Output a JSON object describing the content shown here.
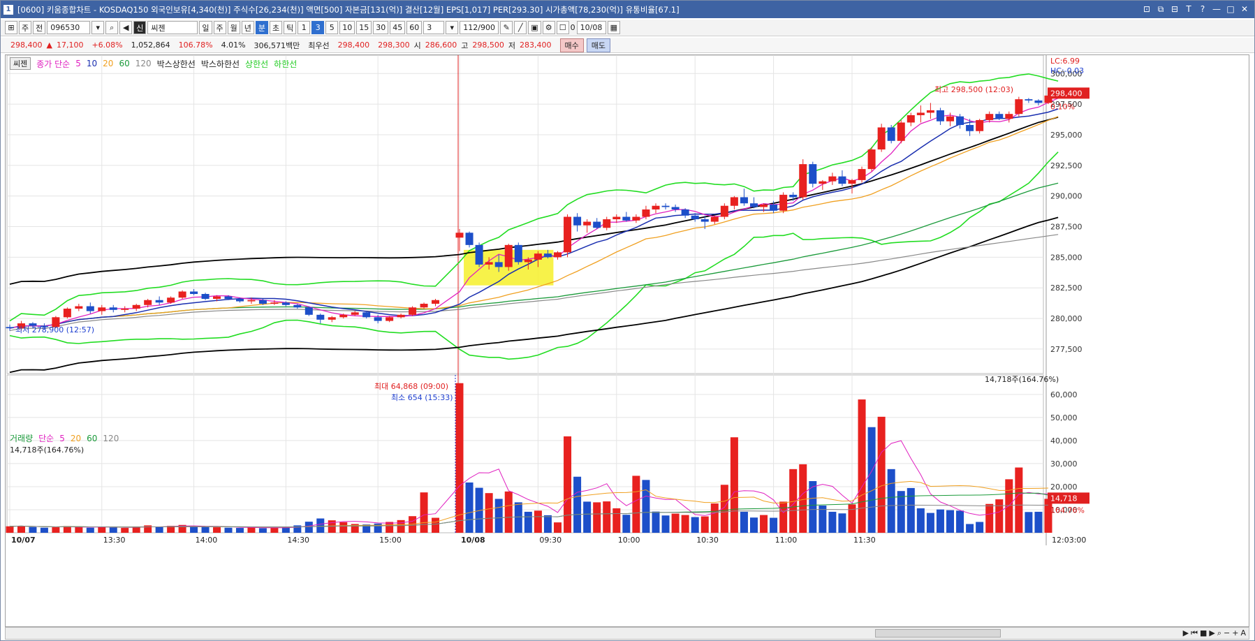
{
  "window": {
    "app_num": "1",
    "title": "[0600] 키움종합차트 - KOSDAQ150 외국인보유[4,340(천)] 주식수[26,234(천)] 액면[500] 자본금[131(억)] 결산[12월] EPS[1,017] PER[293.30] 시가총액[78,230(억)] 유통비율[67.1]",
    "buttons": [
      "⊡",
      "⧉",
      "⊟",
      "T",
      "?",
      "—",
      "□",
      "✕"
    ]
  },
  "toolbar1": {
    "market": "주",
    "all": "전",
    "code": "096530",
    "stock_name": "씨젠",
    "periods": [
      "일",
      "주",
      "월",
      "년",
      "분",
      "초",
      "틱"
    ],
    "active_period": "분",
    "intervals": [
      "1",
      "3",
      "5",
      "10",
      "15",
      "30",
      "45",
      "60"
    ],
    "active_interval": "3",
    "count_value": "3",
    "range": "112/900",
    "checkbox_label": "0",
    "date": "10/08"
  },
  "toolbar2": {
    "price": "298,400",
    "change": "17,100",
    "change_pct": "+6.08%",
    "volume": "1,052,864",
    "volume_pct": "106.78%",
    "turnover": "4.01%",
    "amount": "306,571백만",
    "ask_label": "최우선",
    "ask1": "298,400",
    "bid1": "298,300",
    "open_label": "시",
    "open": "286,600",
    "high_label": "고",
    "high": "298,500",
    "low_label": "저",
    "low": "283,400",
    "buy": "매수",
    "sell": "매도"
  },
  "price_legend": {
    "stock": "씨젠",
    "ma_label": "종가 단순",
    "ma_periods": [
      "5",
      "10",
      "20",
      "60",
      "120"
    ],
    "box_upper": "박스상한선",
    "box_lower": "박스하한선",
    "upper_band": "상한선",
    "lower_band": "하한선"
  },
  "volume_legend": {
    "name": "거래량",
    "ma_label": "단순",
    "ma_periods": [
      "5",
      "20",
      "60",
      "120"
    ],
    "current": "14,718주(164.76%)"
  },
  "annotations": {
    "lc": "LC:6.99",
    "hc": "HC:-0.03",
    "price_tag": "298,400",
    "price_pct": "0.10%",
    "max_price": "최고 298,500 (12:03)",
    "min_price": "최저 278,900 (12:57)",
    "vol_max": "최대 64,868 (09:00)",
    "vol_min": "최소 654 (15:33)",
    "vol_tag": "14,718",
    "vol_pct": "164.76%",
    "vol_current_right": "14,718주(164.76%)"
  },
  "colors": {
    "up": "#e8211f",
    "down": "#1d4fc9",
    "ma5": "#e020c0",
    "ma10": "#1a2fb0",
    "ma20": "#f0a020",
    "ma60": "#1a9a3a",
    "ma120": "#888888",
    "band": "#22dd22",
    "envelope": "#000000"
  },
  "chart_data": {
    "type": "candlestick",
    "y_ticks": [
      "300,000",
      "297,500",
      "295,000",
      "292,500",
      "290,000",
      "287,500",
      "285,000",
      "282,500",
      "280,000",
      "277,500"
    ],
    "y_range": [
      275500,
      301500
    ],
    "vol_ticks": [
      "60,000",
      "50,000",
      "40,000",
      "30,000",
      "20,000",
      "10,000"
    ],
    "vol_range": [
      0,
      66000
    ],
    "x_labels": [
      "10/07",
      "13:30",
      "14:00",
      "14:30",
      "15:00",
      "10/08",
      "09:30",
      "10:00",
      "10:30",
      "11:00",
      "11:30",
      "12:03:00"
    ],
    "prev_day_candles": [
      [
        279.3,
        279.5,
        279.0,
        279.2
      ],
      [
        279.2,
        279.8,
        279.0,
        279.6
      ],
      [
        279.6,
        279.7,
        279.2,
        279.4
      ],
      [
        279.4,
        279.6,
        279.1,
        279.3
      ],
      [
        279.3,
        280.2,
        279.2,
        280.1
      ],
      [
        280.1,
        280.9,
        280.0,
        280.8
      ],
      [
        280.8,
        281.2,
        280.6,
        281.0
      ],
      [
        281.0,
        281.3,
        280.4,
        280.6
      ],
      [
        280.6,
        281.1,
        280.3,
        280.9
      ],
      [
        280.9,
        281.1,
        280.5,
        280.7
      ],
      [
        280.7,
        281.0,
        280.5,
        280.8
      ],
      [
        280.8,
        281.2,
        280.6,
        281.1
      ],
      [
        281.1,
        281.6,
        280.9,
        281.5
      ],
      [
        281.5,
        281.8,
        281.1,
        281.3
      ],
      [
        281.3,
        281.8,
        281.2,
        281.7
      ],
      [
        281.7,
        282.3,
        281.6,
        282.2
      ],
      [
        282.2,
        282.4,
        281.9,
        282.0
      ],
      [
        282.0,
        282.1,
        281.5,
        281.6
      ],
      [
        281.6,
        281.9,
        281.4,
        281.8
      ],
      [
        281.8,
        281.9,
        281.5,
        281.6
      ],
      [
        281.6,
        281.7,
        281.3,
        281.4
      ],
      [
        281.4,
        281.7,
        281.2,
        281.5
      ],
      [
        281.5,
        281.6,
        281.1,
        281.2
      ],
      [
        281.2,
        281.5,
        281.1,
        281.3
      ],
      [
        281.3,
        281.4,
        281.0,
        281.1
      ],
      [
        281.1,
        281.2,
        280.8,
        280.9
      ],
      [
        280.9,
        281.0,
        280.2,
        280.3
      ],
      [
        280.3,
        280.4,
        279.6,
        279.9
      ],
      [
        279.9,
        280.2,
        279.7,
        280.1
      ],
      [
        280.1,
        280.4,
        280.0,
        280.3
      ],
      [
        280.3,
        280.6,
        280.2,
        280.5
      ],
      [
        280.5,
        280.6,
        280.0,
        280.1
      ],
      [
        280.1,
        280.3,
        279.6,
        279.8
      ],
      [
        279.8,
        280.2,
        279.7,
        280.1
      ],
      [
        280.1,
        280.4,
        280.0,
        280.3
      ],
      [
        280.3,
        281.0,
        280.2,
        280.9
      ],
      [
        280.9,
        281.3,
        280.8,
        281.2
      ],
      [
        281.2,
        281.6,
        281.0,
        281.5
      ]
    ],
    "day_candles": [
      [
        286.6,
        287.3,
        285.5,
        287.0
      ],
      [
        287.0,
        287.1,
        285.8,
        286.0
      ],
      [
        286.0,
        286.2,
        284.2,
        284.4
      ],
      [
        284.4,
        285.0,
        284.0,
        284.6
      ],
      [
        284.6,
        285.2,
        283.8,
        284.2
      ],
      [
        284.2,
        286.1,
        283.9,
        286.0
      ],
      [
        286.0,
        286.2,
        284.4,
        284.6
      ],
      [
        284.6,
        285.0,
        284.0,
        284.8
      ],
      [
        284.8,
        285.5,
        284.2,
        285.3
      ],
      [
        285.3,
        285.6,
        284.9,
        285.0
      ],
      [
        285.0,
        285.5,
        284.8,
        285.4
      ],
      [
        285.4,
        288.5,
        285.0,
        288.3
      ],
      [
        288.3,
        288.6,
        287.1,
        287.6
      ],
      [
        287.6,
        288.1,
        287.0,
        287.9
      ],
      [
        287.9,
        288.2,
        287.3,
        287.4
      ],
      [
        287.4,
        288.3,
        287.2,
        288.1
      ],
      [
        288.1,
        288.5,
        287.8,
        288.3
      ],
      [
        288.3,
        288.7,
        287.9,
        288.0
      ],
      [
        288.0,
        288.5,
        287.8,
        288.3
      ],
      [
        288.3,
        289.2,
        288.1,
        288.9
      ],
      [
        288.9,
        289.4,
        288.6,
        289.2
      ],
      [
        289.2,
        289.4,
        288.9,
        289.1
      ],
      [
        289.1,
        289.3,
        288.7,
        288.9
      ],
      [
        288.9,
        289.0,
        288.2,
        288.4
      ],
      [
        288.4,
        288.6,
        287.9,
        288.1
      ],
      [
        288.1,
        288.4,
        287.3,
        287.9
      ],
      [
        287.9,
        288.4,
        287.7,
        288.3
      ],
      [
        288.3,
        289.4,
        288.1,
        289.2
      ],
      [
        289.2,
        290.0,
        288.9,
        289.9
      ],
      [
        289.9,
        290.6,
        289.2,
        289.4
      ],
      [
        289.4,
        289.9,
        289.0,
        289.1
      ],
      [
        289.1,
        289.4,
        288.7,
        289.3
      ],
      [
        289.3,
        289.6,
        288.6,
        288.8
      ],
      [
        288.8,
        290.3,
        288.6,
        290.1
      ],
      [
        290.1,
        290.3,
        289.6,
        289.9
      ],
      [
        289.9,
        293.0,
        289.7,
        292.6
      ],
      [
        292.6,
        292.8,
        290.7,
        291.0
      ],
      [
        291.0,
        291.3,
        290.5,
        291.2
      ],
      [
        291.2,
        291.9,
        290.9,
        291.6
      ],
      [
        291.6,
        292.1,
        290.8,
        291.0
      ],
      [
        291.0,
        291.4,
        290.2,
        291.3
      ],
      [
        291.3,
        292.4,
        291.1,
        292.2
      ],
      [
        292.2,
        294.0,
        292.0,
        293.8
      ],
      [
        293.8,
        295.9,
        293.6,
        295.6
      ],
      [
        295.6,
        295.8,
        294.3,
        294.5
      ],
      [
        294.5,
        296.2,
        294.3,
        296.0
      ],
      [
        296.0,
        296.8,
        295.7,
        296.6
      ],
      [
        296.6,
        297.4,
        296.0,
        296.8
      ],
      [
        296.8,
        297.6,
        296.3,
        297.0
      ],
      [
        297.0,
        297.2,
        295.8,
        296.1
      ],
      [
        296.1,
        296.8,
        295.7,
        296.5
      ],
      [
        296.5,
        296.7,
        295.5,
        295.8
      ],
      [
        295.8,
        296.3,
        294.9,
        295.3
      ],
      [
        295.3,
        296.3,
        295.1,
        296.2
      ],
      [
        296.2,
        296.9,
        296.0,
        296.7
      ],
      [
        296.7,
        296.9,
        296.2,
        296.3
      ],
      [
        296.3,
        296.9,
        296.0,
        296.7
      ],
      [
        296.7,
        298.1,
        296.5,
        297.9
      ],
      [
        297.9,
        298.0,
        297.6,
        297.8
      ],
      [
        297.8,
        297.9,
        297.4,
        297.6
      ],
      [
        297.6,
        298.5,
        297.5,
        298.2
      ],
      [
        298.2,
        298.5,
        298.1,
        298.4
      ]
    ],
    "prev_volumes": [
      [
        2800,
        1
      ],
      [
        3000,
        1
      ],
      [
        2500,
        0
      ],
      [
        2200,
        0
      ],
      [
        2400,
        1
      ],
      [
        2900,
        1
      ],
      [
        2600,
        1
      ],
      [
        2200,
        0
      ],
      [
        2500,
        1
      ],
      [
        2300,
        0
      ],
      [
        2100,
        1
      ],
      [
        2700,
        1
      ],
      [
        3200,
        1
      ],
      [
        2600,
        0
      ],
      [
        3000,
        1
      ],
      [
        3400,
        1
      ],
      [
        2800,
        0
      ],
      [
        2500,
        0
      ],
      [
        2400,
        1
      ],
      [
        2200,
        0
      ],
      [
        2100,
        0
      ],
      [
        2300,
        1
      ],
      [
        2000,
        0
      ],
      [
        2200,
        1
      ],
      [
        2400,
        0
      ],
      [
        3200,
        0
      ],
      [
        4800,
        0
      ],
      [
        6200,
        0
      ],
      [
        5400,
        1
      ],
      [
        4600,
        1
      ],
      [
        3800,
        1
      ],
      [
        3600,
        0
      ],
      [
        4000,
        0
      ],
      [
        4700,
        1
      ],
      [
        5500,
        1
      ],
      [
        7200,
        1
      ],
      [
        17500,
        1
      ],
      [
        6500,
        1
      ]
    ],
    "day_volumes": [
      [
        64868,
        1
      ],
      [
        21800,
        0
      ],
      [
        19500,
        0
      ],
      [
        17200,
        1
      ],
      [
        14700,
        0
      ],
      [
        17900,
        1
      ],
      [
        13200,
        0
      ],
      [
        9100,
        0
      ],
      [
        9600,
        1
      ],
      [
        7600,
        0
      ],
      [
        4500,
        1
      ],
      [
        41800,
        1
      ],
      [
        24300,
        0
      ],
      [
        13500,
        0
      ],
      [
        13200,
        1
      ],
      [
        13600,
        1
      ],
      [
        10600,
        1
      ],
      [
        7800,
        0
      ],
      [
        24700,
        1
      ],
      [
        22900,
        0
      ],
      [
        9200,
        0
      ],
      [
        7500,
        0
      ],
      [
        8300,
        1
      ],
      [
        7700,
        1
      ],
      [
        6800,
        0
      ],
      [
        7100,
        1
      ],
      [
        12700,
        1
      ],
      [
        20800,
        1
      ],
      [
        41400,
        1
      ],
      [
        9100,
        0
      ],
      [
        6600,
        0
      ],
      [
        7700,
        1
      ],
      [
        6500,
        0
      ],
      [
        13500,
        1
      ],
      [
        27600,
        1
      ],
      [
        29700,
        1
      ],
      [
        22400,
        0
      ],
      [
        11800,
        0
      ],
      [
        9100,
        0
      ],
      [
        8400,
        0
      ],
      [
        12300,
        1
      ],
      [
        57800,
        1
      ],
      [
        45800,
        0
      ],
      [
        50300,
        1
      ],
      [
        27600,
        0
      ],
      [
        18100,
        0
      ],
      [
        19400,
        0
      ],
      [
        10600,
        0
      ],
      [
        8600,
        0
      ],
      [
        10100,
        0
      ],
      [
        9800,
        0
      ],
      [
        9600,
        0
      ],
      [
        3800,
        0
      ],
      [
        4700,
        0
      ],
      [
        12500,
        1
      ],
      [
        14500,
        1
      ],
      [
        23200,
        1
      ],
      [
        28300,
        1
      ],
      [
        9000,
        0
      ],
      [
        9100,
        0
      ],
      [
        14718,
        1
      ]
    ]
  }
}
